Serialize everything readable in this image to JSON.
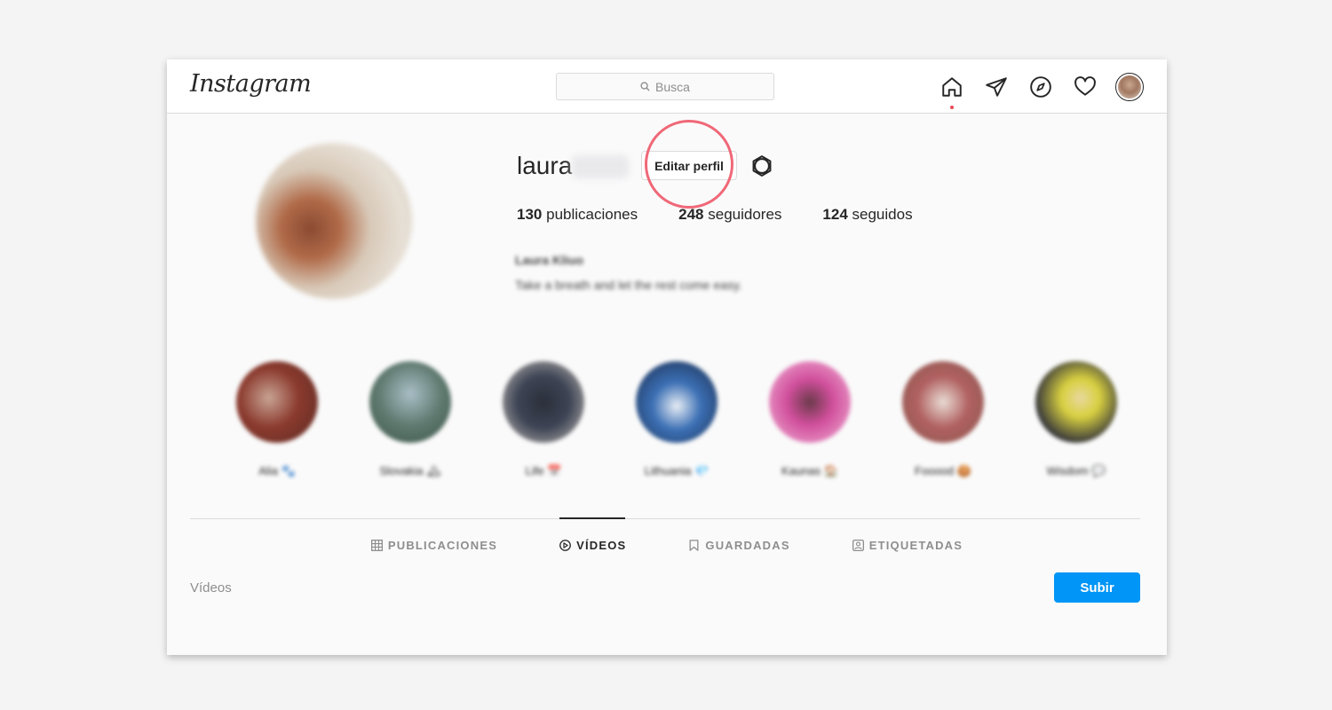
{
  "topbar": {
    "logo": "Instagram",
    "search_placeholder": "Busca",
    "icons": [
      "home-icon",
      "direct-icon",
      "explore-icon",
      "activity-icon",
      "avatar"
    ]
  },
  "profile": {
    "username": "laura",
    "edit_button": "Editar perfil",
    "stats": [
      {
        "count": "130",
        "label": "publicaciones"
      },
      {
        "count": "248",
        "label": "seguidores"
      },
      {
        "count": "124",
        "label": "seguidos"
      }
    ],
    "bio_name": "Laura Kliuo",
    "bio_text": "Take a breath and let the rest come easy."
  },
  "highlights": [
    {
      "label": "Alia 🐾",
      "color": "#8b3a2e"
    },
    {
      "label": "Slovakia 🏔",
      "color": "#5f7a70"
    },
    {
      "label": "Life 📅",
      "color": "#3d4455"
    },
    {
      "label": "Lithuania 💎",
      "color": "#3b6fb4"
    },
    {
      "label": "Kaunas 🏠",
      "color": "#d14f9c"
    },
    {
      "label": "Fooood 🍪",
      "color": "#b06060"
    },
    {
      "label": "Wisdom 💬",
      "color": "#3a3a3a"
    }
  ],
  "tabs": [
    {
      "label": "PUBLICACIONES",
      "icon": "grid-icon",
      "active": false
    },
    {
      "label": "VÍDEOS",
      "icon": "play-icon",
      "active": true
    },
    {
      "label": "GUARDADAS",
      "icon": "bookmark-icon",
      "active": false
    },
    {
      "label": "ETIQUETADAS",
      "icon": "tag-icon",
      "active": false
    }
  ],
  "content": {
    "section_title": "Vídeos",
    "upload_button": "Subir"
  },
  "colors": {
    "accent": "#0095f6",
    "highlight_ring": "#f06878"
  }
}
